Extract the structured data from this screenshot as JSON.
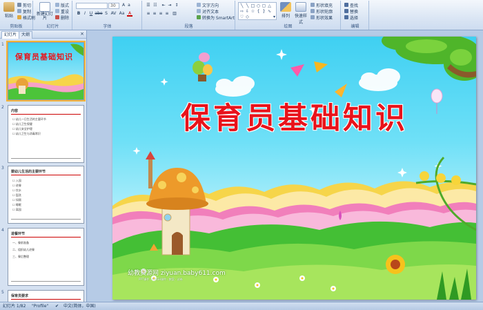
{
  "ribbon": {
    "clipboard": {
      "label": "剪贴板",
      "paste": "粘贴",
      "cut": "剪切",
      "copy": "复制",
      "format_painter": "格式刷"
    },
    "slides": {
      "label": "幻灯片",
      "new_slide": "新建幻灯片",
      "layout": "版式",
      "reset": "重设",
      "delete": "删除"
    },
    "font": {
      "label": "字体",
      "font_name": "",
      "font_size": "30",
      "bold": "B",
      "italic": "I",
      "underline": "U",
      "strike": "abe",
      "shadow": "S",
      "spacing": "AV",
      "case": "Aa",
      "color": "A"
    },
    "paragraph": {
      "label": "段落",
      "text_direction": "文字方向",
      "align_text": "对齐文本",
      "smartart": "转换为 SmartArt"
    },
    "drawing": {
      "label": "绘图",
      "arrange": "排列",
      "quick_styles": "快速样式",
      "fill": "形状填充",
      "outline": "形状轮廓",
      "effects": "形状效果"
    },
    "editing": {
      "label": "编辑",
      "find": "查找",
      "replace": "替换",
      "select": "选择"
    }
  },
  "pane": {
    "tab_slides": "幻灯片",
    "tab_outline": "大纲",
    "close": "×",
    "thumbs": [
      {
        "num": "1",
        "title": "保育员基础知识"
      },
      {
        "num": "2",
        "title": "内容",
        "lines": [
          "☐ 幼儿一日生活的主要环节",
          "☐ 幼儿卫生保健",
          "☐ 幼儿安全护理",
          "☐ 幼儿卫生与消毒常识"
        ]
      },
      {
        "num": "3",
        "title": "婴幼儿生活的主要环节",
        "lines": [
          "☐ 入园",
          "☐ 进餐",
          "☐ 饮水",
          "☐ 盥洗",
          "☐ 如厕",
          "☐ 睡眠",
          "☐ 离园"
        ]
      },
      {
        "num": "4",
        "title": "进餐环节",
        "lines": [
          "一、餐前准备",
          "二、组织幼儿进餐",
          "三、餐后整理"
        ]
      },
      {
        "num": "5",
        "title": "保育员要求"
      }
    ]
  },
  "slide": {
    "title": "保育员基础知识",
    "watermark": "幼教资源网 ziyuan.baby611.com",
    "watermark_sub": "PPT课件 · FLASH课件 · 教案 · 试卷"
  },
  "status": {
    "slide_counter": "幻灯片 1/82",
    "theme": "\"Profile\"",
    "language": "中文(简体，中国)"
  },
  "colors": {
    "title_red": "#e8131b",
    "ribbon_blue": "#dbe6f4",
    "selection": "#f3b436"
  }
}
